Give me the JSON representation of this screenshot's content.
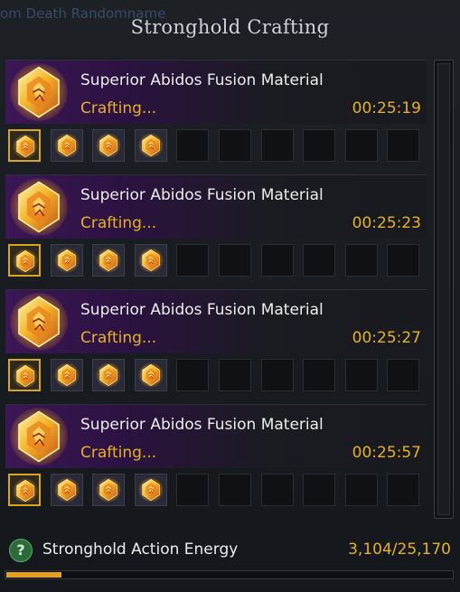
{
  "window": {
    "title": "Stronghold Crafting",
    "bg_tag": "om Death Randomname"
  },
  "crafts": [
    {
      "name": "Superior Abidos Fusion Material",
      "status": "Crafting...",
      "timer": "00:25:19",
      "icon": "fusion-material-icon",
      "slots": {
        "total": 10,
        "filled": 4,
        "active_index": 0
      }
    },
    {
      "name": "Superior Abidos Fusion Material",
      "status": "Crafting...",
      "timer": "00:25:23",
      "icon": "fusion-material-icon",
      "slots": {
        "total": 10,
        "filled": 4,
        "active_index": 0
      }
    },
    {
      "name": "Superior Abidos Fusion Material",
      "status": "Crafting...",
      "timer": "00:25:27",
      "icon": "fusion-material-icon",
      "slots": {
        "total": 10,
        "filled": 4,
        "active_index": 0
      }
    },
    {
      "name": "Superior Abidos Fusion Material",
      "status": "Crafting...",
      "timer": "00:25:57",
      "icon": "fusion-material-icon",
      "slots": {
        "total": 10,
        "filled": 4,
        "active_index": 0
      }
    }
  ],
  "footer": {
    "help_icon": "question-icon",
    "help_glyph": "?",
    "label": "Stronghold Action Energy",
    "value": "3,104/25,170",
    "fraction": 0.1233
  },
  "colors": {
    "accent_gold": "#e6b125",
    "header_purple": "#3c1657",
    "help_green": "#2c6a3a"
  }
}
